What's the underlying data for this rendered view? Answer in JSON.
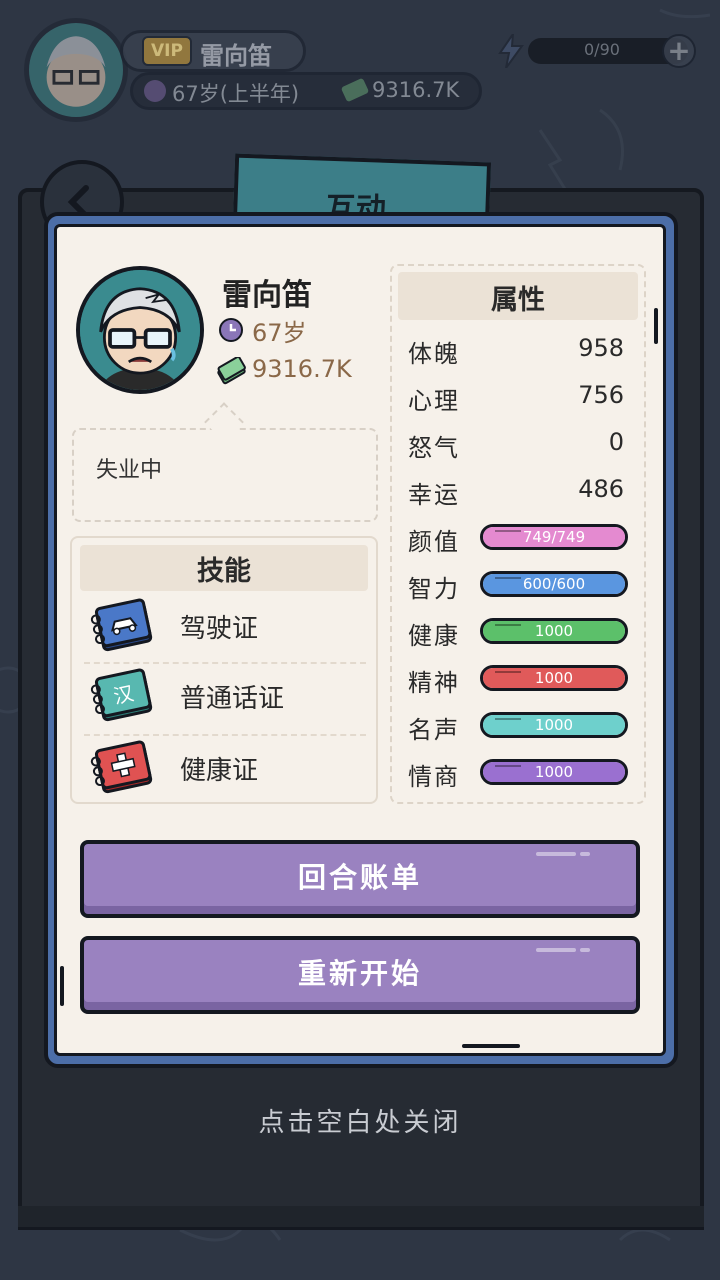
{
  "hud": {
    "vip": "VIP",
    "name": "雷向笛",
    "age": "67岁(上半年)",
    "money": "9316.7K",
    "energy": "0/90",
    "energy_plus": "+"
  },
  "tab": {
    "label": "互动"
  },
  "profile": {
    "name": "雷向笛",
    "age": "67岁",
    "money": "9316.7K",
    "status": "失业中"
  },
  "skills": {
    "title": "技能",
    "items": [
      {
        "label": "驾驶证",
        "icon": "car-book-icon",
        "color": "#4a78c8"
      },
      {
        "label": "普通话证",
        "icon": "han-book-icon",
        "color": "#4ca6a0",
        "glyph": "汉"
      },
      {
        "label": "健康证",
        "icon": "health-book-icon",
        "color": "#e04a4a"
      }
    ]
  },
  "attributes": {
    "title": "属性",
    "stats": [
      {
        "name": "体魄",
        "value": "958"
      },
      {
        "name": "心理",
        "value": "756"
      },
      {
        "name": "怒气",
        "value": "0"
      },
      {
        "name": "幸运",
        "value": "486"
      }
    ],
    "bars": [
      {
        "name": "颜值",
        "text": "749/749",
        "fill": 1.0,
        "color": "#e48ad0"
      },
      {
        "name": "智力",
        "text": "600/600",
        "fill": 1.0,
        "color": "#5a96e0"
      },
      {
        "name": "健康",
        "text": "1000",
        "fill": 1.0,
        "color": "#5cc06a"
      },
      {
        "name": "精神",
        "text": "1000",
        "fill": 1.0,
        "color": "#e05a5a"
      },
      {
        "name": "名声",
        "text": "1000",
        "fill": 1.0,
        "color": "#6ed0cc"
      },
      {
        "name": "情商",
        "text": "1000",
        "fill": 1.0,
        "color": "#9a70d0"
      }
    ]
  },
  "buttons": {
    "round_bill": "回合账单",
    "restart": "重新开始"
  },
  "close_hint": "点击空白处关闭"
}
